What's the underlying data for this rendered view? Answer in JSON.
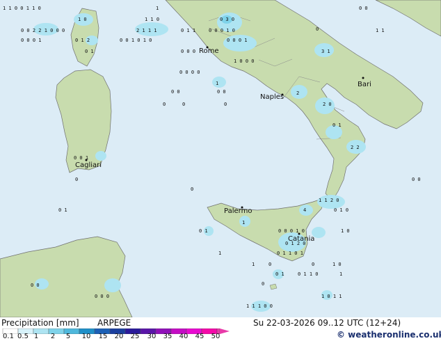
{
  "colors": {
    "sea": "#dcecf6",
    "land": "#c8dcae",
    "precip_light": "#aee4f2",
    "precip_mid": "#7fd3ea",
    "legend_bar": [
      "#ffffff",
      "#d7f2fa",
      "#aee4f2",
      "#7fd3ea",
      "#4fb8dc",
      "#1f8fc8",
      "#1b5fb5",
      "#1a3f9e",
      "#2a1a9a",
      "#5a15a8",
      "#8f10b8",
      "#c40dc4",
      "#e80ad0",
      "#f40aa8",
      "#e83aa8"
    ]
  },
  "cities": [
    {
      "name": "Rome"
    },
    {
      "name": "Naples"
    },
    {
      "name": "Bari"
    },
    {
      "name": "Cagliari"
    },
    {
      "name": "Palermo"
    },
    {
      "name": "Catania"
    }
  ],
  "footer": {
    "title": "Precipitation [mm]",
    "model": "ARPEGE",
    "datetime": "Su 22-03-2026 09..12 UTC (12+24)",
    "copyright": "© weatheronline.co.uk",
    "legend_ticks": [
      "0.1",
      "0.5",
      "1",
      "2",
      "5",
      "10",
      "15",
      "20",
      "25",
      "30",
      "35",
      "40",
      "45",
      "50"
    ]
  }
}
